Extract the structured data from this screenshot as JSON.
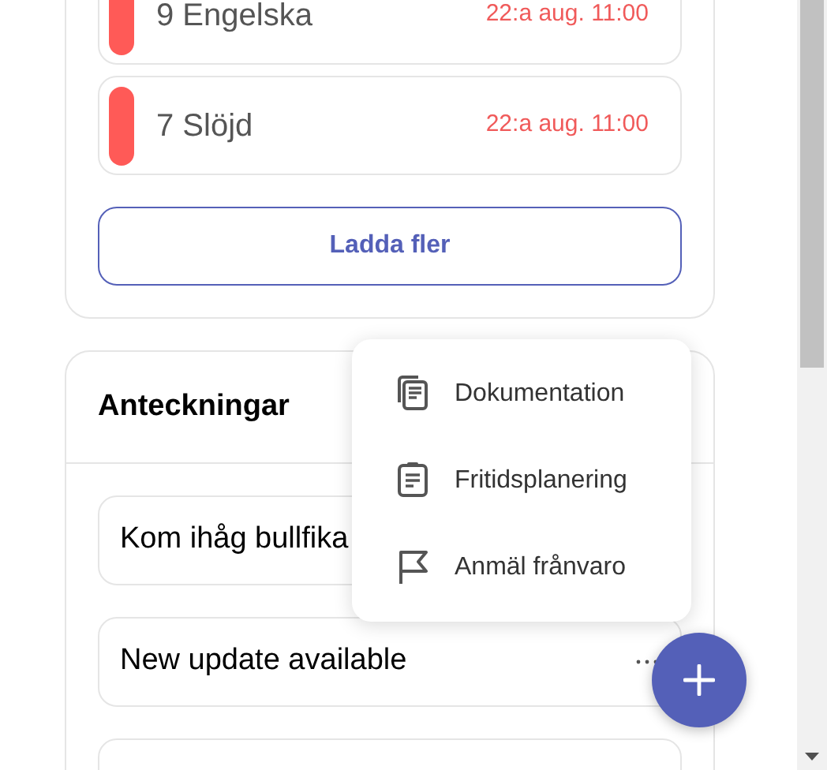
{
  "assignments": [
    {
      "title": "9 Engelska",
      "due": "22:a aug. 11:00",
      "color": "#ff5a57"
    },
    {
      "title": "7 Slöjd",
      "due": "22:a aug. 11:00",
      "color": "#ff5a57"
    }
  ],
  "load_more": "Ladda fler",
  "notes": {
    "title": "Anteckningar",
    "items": [
      {
        "text": "Kom ihåg bullfika",
        "more": false
      },
      {
        "text": "New update available",
        "more": true
      },
      {
        "more": false
      }
    ]
  },
  "menu": [
    {
      "label": "Dokumentation",
      "kind": "documents"
    },
    {
      "label": "Fritidsplanering",
      "kind": "clipboard"
    },
    {
      "label": "Anmäl frånvaro",
      "kind": "flag"
    }
  ]
}
